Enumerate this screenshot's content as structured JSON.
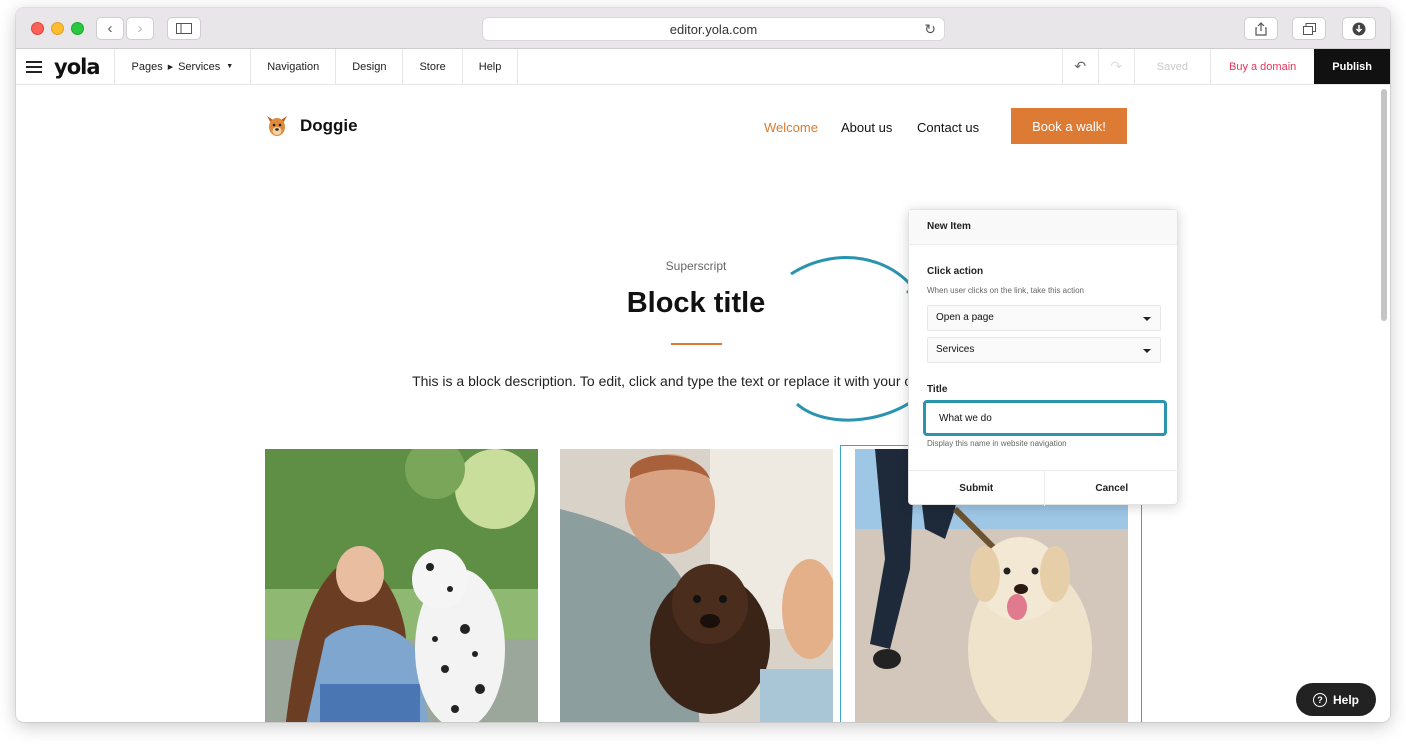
{
  "browser": {
    "url": "editor.yola.com"
  },
  "toolbar": {
    "logo": "yola",
    "pages_label": "Pages",
    "current_page": "Services",
    "menu": [
      "Navigation",
      "Design",
      "Store",
      "Help"
    ],
    "saved_label": "Saved",
    "buy_domain_label": "Buy a domain",
    "publish_label": "Publish"
  },
  "site": {
    "name": "Doggie",
    "nav": [
      "Welcome",
      "About us",
      "Contact us"
    ],
    "active_nav": "Welcome",
    "cta_label": "Book a walk!",
    "superscript": "Superscript",
    "block_title": "Block title",
    "block_description": "This is a block description. To edit, click and type the text or replace it with your own content"
  },
  "popup": {
    "header": "New Item",
    "click_action_label": "Click action",
    "click_action_hint": "When user clicks on the link, take this action",
    "action_value": "Open a page",
    "page_value": "Services",
    "title_label": "Title",
    "title_value": "What we do",
    "title_hint": "Display this name in website navigation",
    "submit_label": "Submit",
    "cancel_label": "Cancel"
  },
  "help_label": "Help",
  "colors": {
    "accent_orange": "#dd7a33",
    "highlight_teal": "#2a94ae",
    "buy_domain_red": "#e8325a"
  }
}
